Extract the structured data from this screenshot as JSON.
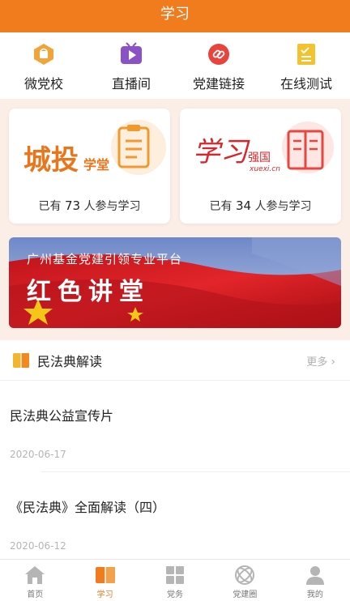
{
  "header": {
    "title": "学习"
  },
  "quick_links": [
    {
      "label": "微党校",
      "icon": "party-school-icon"
    },
    {
      "label": "直播间",
      "icon": "live-icon"
    },
    {
      "label": "党建链接",
      "icon": "link-icon"
    },
    {
      "label": "在线测试",
      "icon": "test-icon"
    }
  ],
  "cards": [
    {
      "brand_main": "城投",
      "brand_sub": "学堂",
      "count_prefix": "已有",
      "count": "73",
      "count_suffix": "人参与学习"
    },
    {
      "brand_main": "学习",
      "brand_sub": "强国",
      "brand_url": "xuexi.cn",
      "count_prefix": "已有",
      "count": "34",
      "count_suffix": "人参与学习"
    }
  ],
  "banner": {
    "subtitle": "广州基金党建引领专业平台",
    "title": "红色讲堂"
  },
  "section": {
    "title": "民法典解读",
    "more": "更多"
  },
  "articles": [
    {
      "title": "民法典公益宣传片",
      "date": "2020-06-17"
    },
    {
      "title": "《民法典》全面解读（四）",
      "date": "2020-06-12"
    }
  ],
  "tabs": [
    {
      "label": "首页",
      "icon": "home-icon",
      "active": false
    },
    {
      "label": "学习",
      "icon": "study-icon",
      "active": true
    },
    {
      "label": "党务",
      "icon": "party-affairs-icon",
      "active": false
    },
    {
      "label": "党建圈",
      "icon": "party-circle-icon",
      "active": false
    },
    {
      "label": "我的",
      "icon": "profile-icon",
      "active": false
    }
  ],
  "colors": {
    "accent": "#f07c1e",
    "card_bg": "#fbeee6"
  }
}
